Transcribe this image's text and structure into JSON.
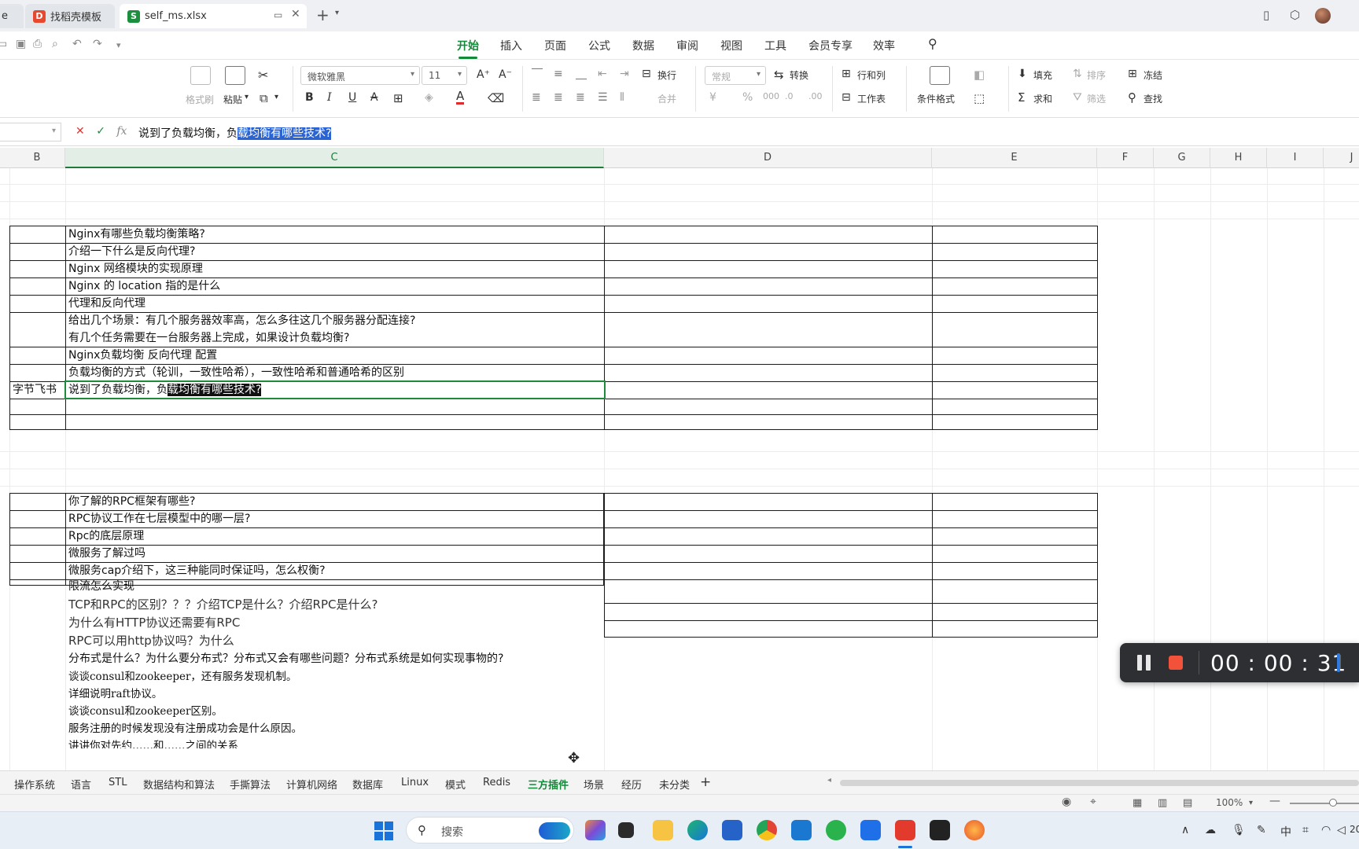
{
  "window": {
    "tabs": [
      {
        "label": "e"
      },
      {
        "label": "找稻壳模板"
      },
      {
        "label": "self_ms.xlsx"
      }
    ]
  },
  "menu": {
    "items": [
      "开始",
      "插入",
      "页面",
      "公式",
      "数据",
      "审阅",
      "视图",
      "工具",
      "会员专享",
      "效率"
    ],
    "active": "开始"
  },
  "ribbon": {
    "format_painter": "格式刷",
    "paste": "粘贴",
    "font_name": "微软雅黑",
    "font_size": "11",
    "bold": "B",
    "italic": "I",
    "underline": "U",
    "strike": "A",
    "wrap": "换行",
    "merge": "合并",
    "number_format": "常规",
    "convert": "转换",
    "rows_cols": "行和列",
    "worksheet": "工作表",
    "conditional_format": "条件格式",
    "fill": "填充",
    "sort": "排序",
    "freeze": "冻结",
    "sum": "求和",
    "filter": "筛选",
    "find": "查找"
  },
  "formula_bar": {
    "text_plain": "说到了负载均衡，负",
    "text_selected": "载均衡有哪些技术?",
    "fx": "fx"
  },
  "columns": [
    "B",
    "C",
    "D",
    "E",
    "F",
    "G",
    "H",
    "I",
    "J"
  ],
  "active_column": "C",
  "block1": {
    "rows": [
      "Nginx有哪些负载均衡策略?",
      "介绍一下什么是反向代理?",
      "Nginx 网络模块的实现原理",
      "Nginx 的 location 指的是什么",
      "代理和反向代理",
      "给出几个场景：有几个服务器效率高，怎么多往这几个服务器分配连接?",
      " 有几个任务需要在一台服务器上完成，如果设计负载均衡?",
      "Nginx负载均衡 反向代理 配置",
      "负载均衡的方式（轮训，一致性哈希），一致性哈希和普通哈希的区别"
    ],
    "active_row_b": "字节飞书",
    "active_row_plain": "说到了负载均衡，负",
    "active_row_selected": "载均衡有哪些技术?"
  },
  "block2": {
    "rows": [
      "你了解的RPC框架有哪些?",
      "RPC协议工作在七层模型中的哪一层?",
      "Rpc的底层原理",
      "微服务了解过吗",
      "微服务cap介绍下，这三种能同时保证吗，怎么权衡?",
      "限流怎么实现"
    ],
    "rows_large": [
      "TCP和RPC的区别？？？介绍TCP是什么？介绍RPC是什么?",
      "为什么有HTTP协议还需要有RPC",
      "RPC可以用http协议吗？为什么"
    ],
    "rows_after": [
      "分布式是什么？为什么要分布式？分布式又会有哪些问题？分布式系统是如何实现事物的?"
    ],
    "rows_mono": [
      "谈谈consul和zookeeper，还有服务发现机制。",
      "详细说明raft协议。",
      "谈谈consul和zookeeper区别。",
      "服务注册的时候发现没有注册成功会是什么原因。",
      "讲讲你对先约……和……之间的关系"
    ]
  },
  "sheet_tabs": [
    "操作系统",
    "语言",
    "STL",
    "数据结构和算法",
    "手撕算法",
    "计算机网络",
    "数据库",
    "Linux",
    "模式",
    "Redis",
    "三方插件",
    "场景",
    "经历",
    "未分类"
  ],
  "active_sheet": "三方插件",
  "status": {
    "zoom": "100%"
  },
  "recorder": {
    "time": "00 : 00 : 31"
  },
  "taskbar": {
    "search_placeholder": "搜索",
    "ime": "中",
    "clock": "20"
  },
  "colors": {
    "accent": "#128a3a",
    "selection": "#2a63d3",
    "stop": "#f2513a"
  }
}
